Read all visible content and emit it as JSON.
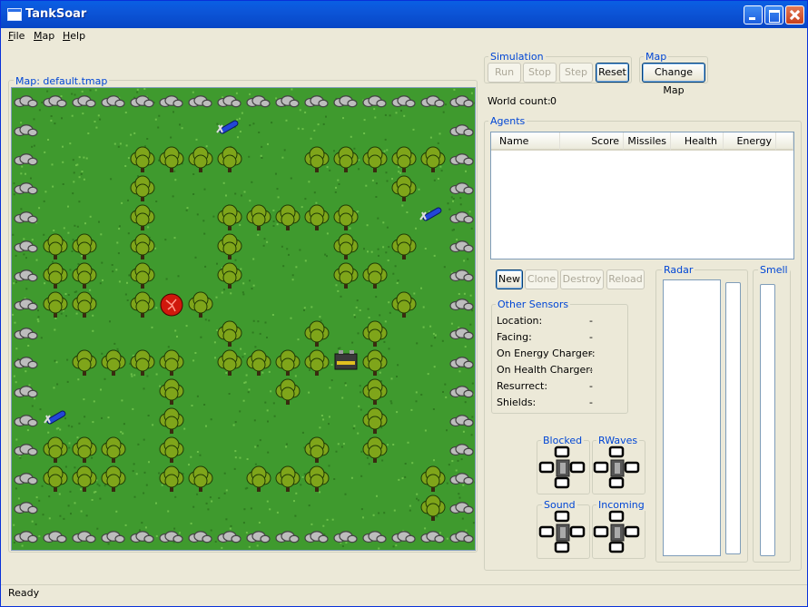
{
  "window": {
    "title": "TankSoar"
  },
  "menu": {
    "file": "File",
    "map": "Map",
    "help": "Help"
  },
  "map_panel": {
    "legend": "Map: default.tmap",
    "items": {
      "missiles": 3,
      "energy_charger": 1,
      "health_charger": 1
    }
  },
  "simulation": {
    "legend": "Simulation",
    "run": "Run",
    "stop": "Stop",
    "step": "Step",
    "reset": "Reset"
  },
  "map_group": {
    "legend": "Map",
    "change_map": "Change Map"
  },
  "world": {
    "label": "World count:",
    "count": "0"
  },
  "agents": {
    "legend": "Agents",
    "columns": [
      "Name",
      "Score",
      "Missiles",
      "Health",
      "Energy"
    ],
    "new": "New",
    "clone": "Clone",
    "destroy": "Destroy",
    "reload": "Reload"
  },
  "sensors": {
    "legend": "Other Sensors",
    "rows": [
      {
        "label": "Location:",
        "value": "-"
      },
      {
        "label": "Facing:",
        "value": "-"
      },
      {
        "label": "On Energy Charger:",
        "value": "-"
      },
      {
        "label": "On Health Charger:",
        "value": "-"
      },
      {
        "label": "Resurrect:",
        "value": "-"
      },
      {
        "label": "Shields:",
        "value": "-"
      }
    ]
  },
  "radar": {
    "legend": "Radar"
  },
  "smell": {
    "legend": "Smell"
  },
  "indicators": {
    "blocked": "Blocked",
    "rwaves": "RWaves",
    "sound": "Sound",
    "incoming": "Incoming"
  },
  "status": {
    "text": "Ready"
  },
  "colors": {
    "title_bar": "#0a5fe3",
    "legend_text": "#0046d5",
    "grass": "#3f9a2e"
  }
}
